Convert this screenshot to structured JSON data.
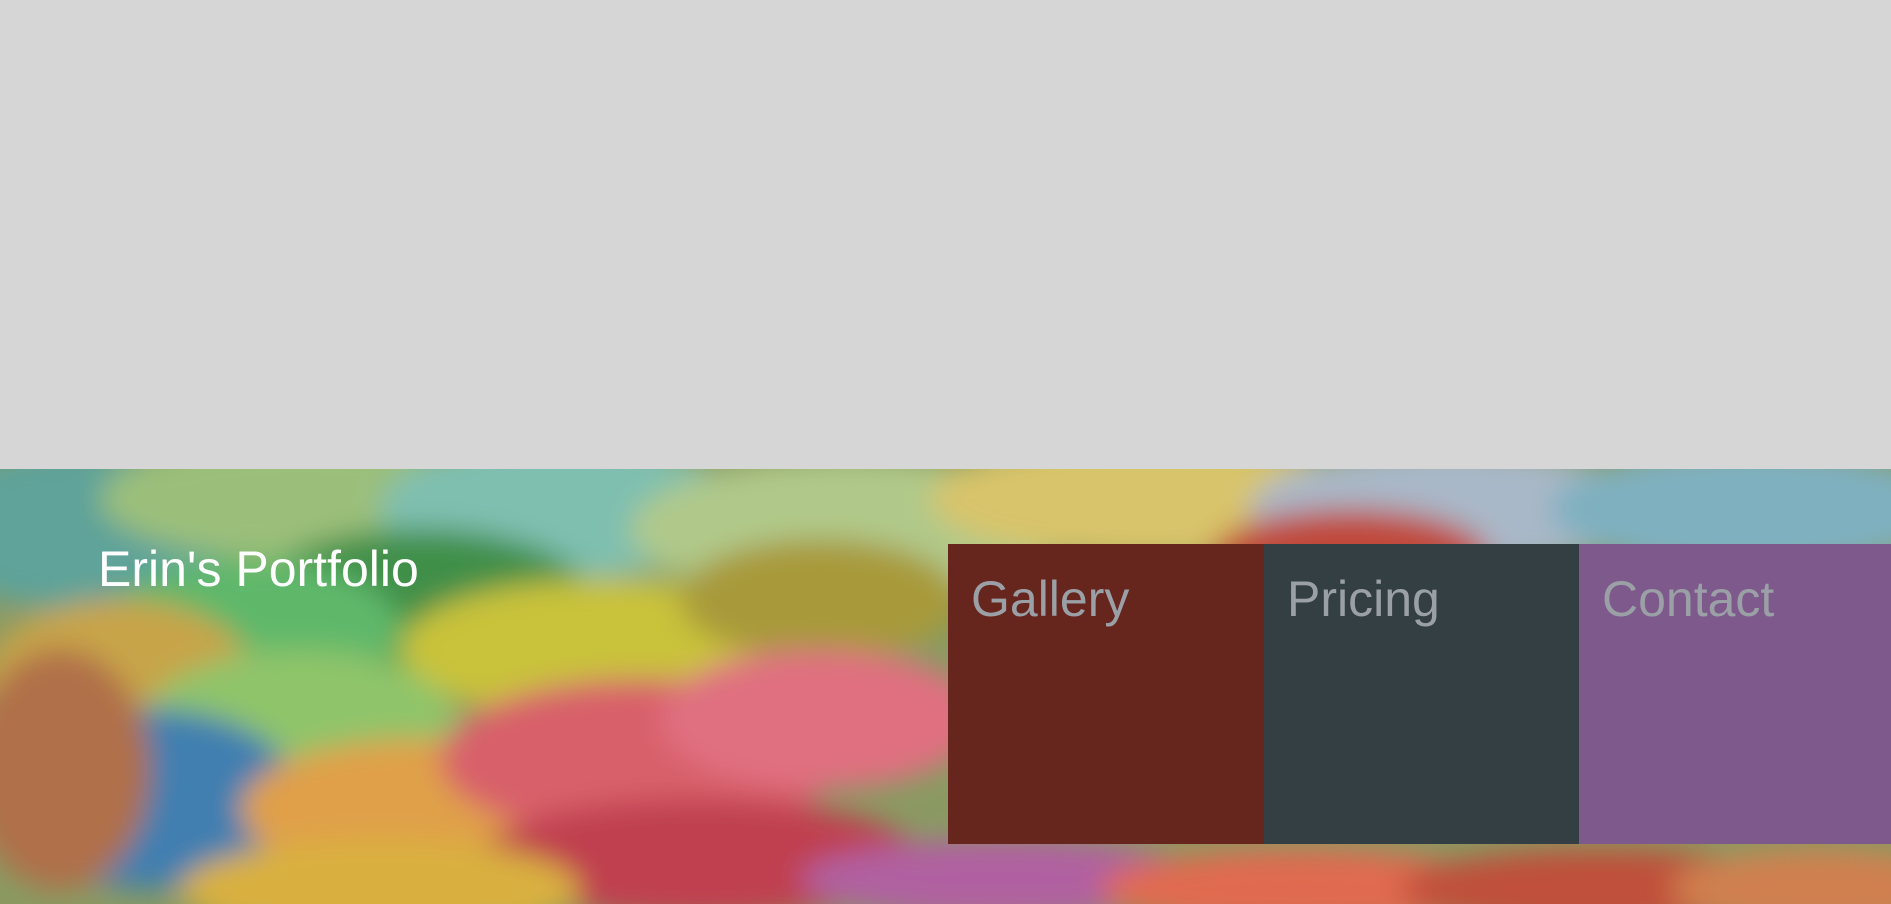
{
  "header": {
    "title": "Erin's Portfolio"
  },
  "nav": {
    "items": [
      {
        "label": "Gallery",
        "color": "#66251d"
      },
      {
        "label": "Pricing",
        "color": "#333f43"
      },
      {
        "label": "Contact",
        "color": "#7e5a8c"
      }
    ],
    "text_color": "#9aa0a6"
  },
  "colors": {
    "page_background": "#d6d6d6",
    "title_color": "#ffffff"
  }
}
